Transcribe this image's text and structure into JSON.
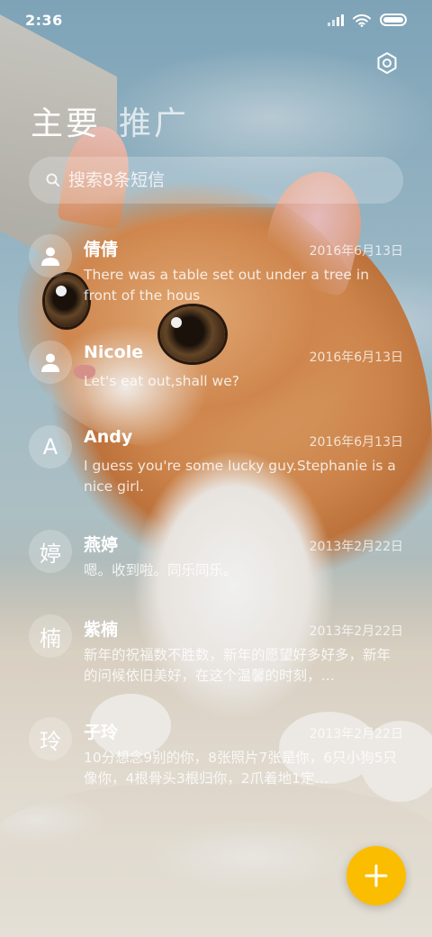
{
  "status_bar": {
    "time": "2:36",
    "icons": [
      "signal-icon",
      "wifi-icon",
      "battery-icon"
    ]
  },
  "header": {
    "settings_icon": "gear-icon",
    "tabs": [
      {
        "label": "主要",
        "active": true
      },
      {
        "label": "推广",
        "active": false
      }
    ]
  },
  "search": {
    "icon": "search-icon",
    "placeholder": "搜索8条短信"
  },
  "conversations": [
    {
      "avatar_type": "person-icon",
      "avatar_text": "",
      "name": "倩倩",
      "date": "2016年6月13日",
      "preview": "There was a table set out under a tree in front of the hous"
    },
    {
      "avatar_type": "person-icon",
      "avatar_text": "",
      "name": "Nicole",
      "date": "2016年6月13日",
      "preview": "Let's eat out,shall we?"
    },
    {
      "avatar_type": "letter",
      "avatar_text": "A",
      "name": "Andy",
      "date": "2016年6月13日",
      "preview": "I guess you're some lucky guy.Stephanie is a nice girl."
    },
    {
      "avatar_type": "letter",
      "avatar_text": "婷",
      "name": "燕婷",
      "date": "2013年2月22日",
      "preview": "嗯。收到啦。同乐同乐。"
    },
    {
      "avatar_type": "letter",
      "avatar_text": "楠",
      "name": "紫楠",
      "date": "2013年2月22日",
      "preview": "新年的祝福数不胜数，新年的愿望好多好多，新年的问候依旧美好，在这个温馨的时刻，…"
    },
    {
      "avatar_type": "letter",
      "avatar_text": "玲",
      "name": "子玲",
      "date": "2013年2月22日",
      "preview": "10分想念9别的你，8张照片7张是你，6只小狗5只像你，4根骨头3根归你，2爪着地1定…"
    }
  ],
  "fab": {
    "icon": "plus-icon",
    "color": "#fbbd00"
  }
}
